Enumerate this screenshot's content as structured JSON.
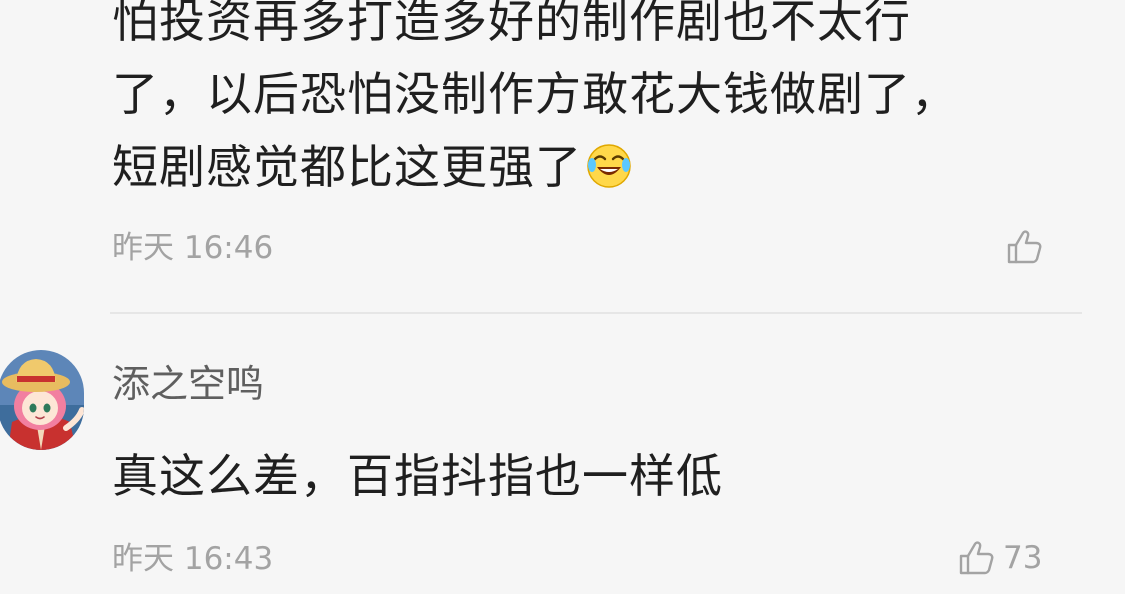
{
  "comments": [
    {
      "lines": [
        "怕投资再多打造多好的制作剧也不太行",
        "了，以后恐怕没制作方敢花大钱做剧了，",
        "短剧感觉都比这更强了"
      ],
      "emoji_icon": "laughing-crying-emoji-icon",
      "time": "昨天 16:46",
      "like_icon": "thumbs-up-icon",
      "like_count": ""
    },
    {
      "username": "添之空鸣",
      "avatar_icon": "anime-girl-straw-hat-avatar",
      "text": "真这么差，百指抖指也一样低",
      "time": "昨天 16:43",
      "like_icon": "thumbs-up-icon",
      "like_count": "73"
    }
  ],
  "colors": {
    "background": "#f6f6f6",
    "text": "#1f1f1f",
    "meta": "#a3a3a3",
    "username": "#5f5f5f",
    "divider": "#e6e6e6"
  }
}
